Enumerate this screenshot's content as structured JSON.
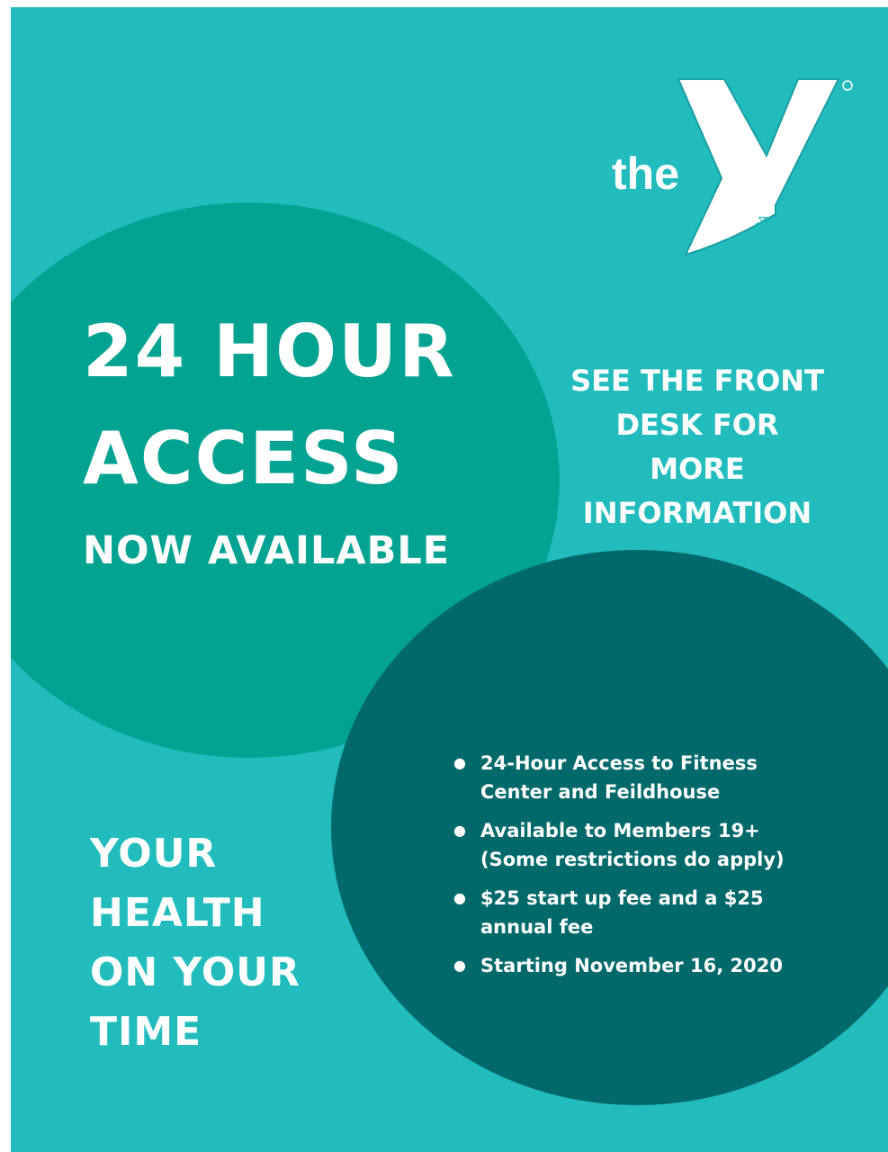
{
  "logo": {
    "word": "the",
    "mark_text": "YMCA",
    "registered": "®"
  },
  "headline": {
    "line1": "24 HOUR",
    "line2": "ACCESS",
    "line3": "NOW AVAILABLE"
  },
  "side_note": {
    "lines": [
      "SEE THE FRONT",
      "DESK FOR",
      "MORE",
      "INFORMATION"
    ]
  },
  "slogan": {
    "lines": [
      "YOUR",
      "HEALTH",
      "ON YOUR",
      "TIME"
    ]
  },
  "bullets": [
    {
      "lines": [
        "24-Hour Access to Fitness",
        "Center and Feildhouse"
      ]
    },
    {
      "lines": [
        "Available to Members 19+",
        "(Some restrictions do apply)"
      ]
    },
    {
      "lines": [
        "$25 start up fee and a $25",
        "annual fee"
      ]
    },
    {
      "lines": [
        "Starting November 16, 2020"
      ]
    }
  ],
  "colors": {
    "background": "#22bcbd",
    "circle_top": "#03a391",
    "circle_bottom": "#02696a",
    "text": "#ffffff"
  }
}
